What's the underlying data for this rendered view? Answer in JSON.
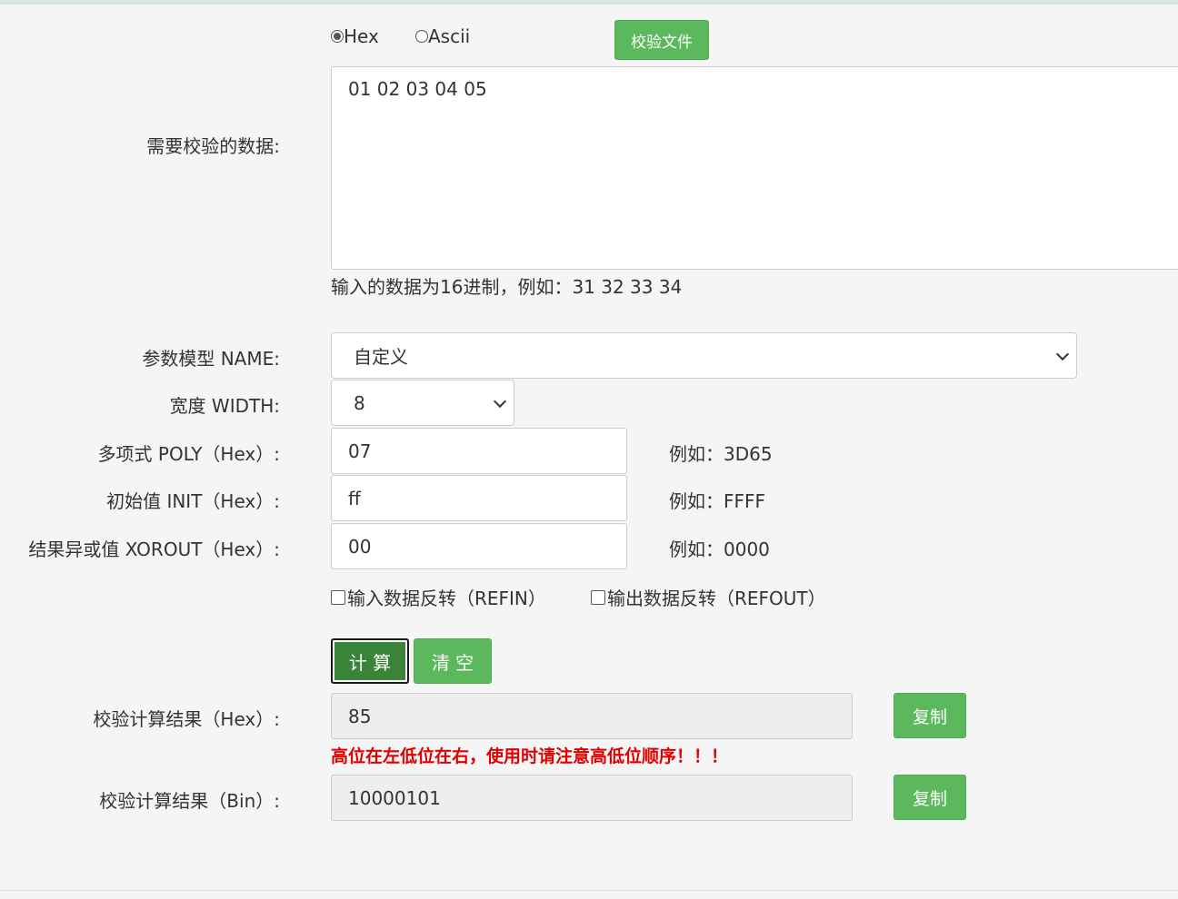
{
  "mode": {
    "hex_label": "Hex",
    "ascii_label": "Ascii",
    "selected": "Hex"
  },
  "verify_file_button": "校验文件",
  "data": {
    "label": "需要校验的数据:",
    "value": "01 02 03 04 05",
    "hint": "输入的数据为16进制，例如：31 32 33 34"
  },
  "model": {
    "label": "参数模型 NAME:",
    "selected": "自定义"
  },
  "width": {
    "label": "宽度 WIDTH:",
    "selected": "8"
  },
  "poly": {
    "label": "多项式 POLY（Hex）:",
    "value": "07",
    "example": "例如：3D65"
  },
  "init": {
    "label": "初始值 INIT（Hex）:",
    "value": "ff",
    "example": "例如：FFFF"
  },
  "xorout": {
    "label": "结果异或值 XOROUT（Hex）:",
    "value": "00",
    "example": "例如：0000"
  },
  "refin": {
    "label": "输入数据反转（REFIN）",
    "checked": false
  },
  "refout": {
    "label": "输出数据反转（REFOUT）",
    "checked": false
  },
  "buttons": {
    "calculate": "计 算",
    "clear": "清 空",
    "copy": "复制"
  },
  "result_hex": {
    "label": "校验计算结果（Hex）:",
    "value": "85"
  },
  "warning": "高位在左低位在右，使用时请注意高低位顺序！！！",
  "result_bin": {
    "label": "校验计算结果（Bin）:",
    "value": "10000101"
  },
  "colors": {
    "button_green": "#5cb85c",
    "button_green_active": "#398439",
    "warning_red": "#e00000"
  }
}
